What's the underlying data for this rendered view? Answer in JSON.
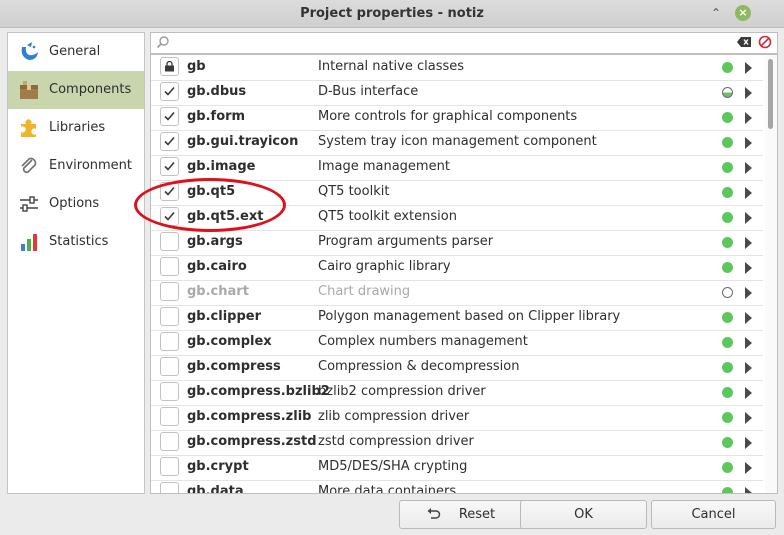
{
  "window": {
    "title": "Project properties - notiz"
  },
  "sidebar": {
    "items": [
      {
        "label": "General",
        "icon": "gambas-logo-icon",
        "active": false
      },
      {
        "label": "Components",
        "icon": "box-icon",
        "active": true
      },
      {
        "label": "Libraries",
        "icon": "puzzle-icon",
        "active": false
      },
      {
        "label": "Environment",
        "icon": "paperclip-icon",
        "active": false
      },
      {
        "label": "Options",
        "icon": "sliders-icon",
        "active": false
      },
      {
        "label": "Statistics",
        "icon": "bar-chart-icon",
        "active": false
      }
    ]
  },
  "search": {
    "value": "",
    "placeholder": ""
  },
  "components": [
    {
      "name": "gb",
      "description": "Internal native classes",
      "state": "locked",
      "status": "ok",
      "disabled": false
    },
    {
      "name": "gb.dbus",
      "description": "D-Bus interface",
      "state": "checked",
      "status": "half",
      "disabled": false
    },
    {
      "name": "gb.form",
      "description": "More controls for graphical components",
      "state": "checked",
      "status": "ok",
      "disabled": false
    },
    {
      "name": "gb.gui.trayicon",
      "description": "System tray icon management component",
      "state": "checked",
      "status": "ok",
      "disabled": false
    },
    {
      "name": "gb.image",
      "description": "Image management",
      "state": "checked",
      "status": "ok",
      "disabled": false
    },
    {
      "name": "gb.qt5",
      "description": "QT5 toolkit",
      "state": "checked",
      "status": "ok",
      "disabled": false
    },
    {
      "name": "gb.qt5.ext",
      "description": "QT5 toolkit extension",
      "state": "checked",
      "status": "ok",
      "disabled": false
    },
    {
      "name": "gb.args",
      "description": "Program arguments parser",
      "state": "unchecked",
      "status": "ok",
      "disabled": false
    },
    {
      "name": "gb.cairo",
      "description": "Cairo graphic library",
      "state": "unchecked",
      "status": "ok",
      "disabled": false
    },
    {
      "name": "gb.chart",
      "description": "Chart drawing",
      "state": "unchecked",
      "status": "empty",
      "disabled": true
    },
    {
      "name": "gb.clipper",
      "description": "Polygon management based on Clipper library",
      "state": "unchecked",
      "status": "ok",
      "disabled": false
    },
    {
      "name": "gb.complex",
      "description": "Complex numbers management",
      "state": "unchecked",
      "status": "ok",
      "disabled": false
    },
    {
      "name": "gb.compress",
      "description": "Compression & decompression",
      "state": "unchecked",
      "status": "ok",
      "disabled": false
    },
    {
      "name": "gb.compress.bzlib2",
      "description": "bzlib2 compression driver",
      "state": "unchecked",
      "status": "ok",
      "disabled": false
    },
    {
      "name": "gb.compress.zlib",
      "description": "zlib compression driver",
      "state": "unchecked",
      "status": "ok",
      "disabled": false
    },
    {
      "name": "gb.compress.zstd",
      "description": "zstd compression driver",
      "state": "unchecked",
      "status": "ok",
      "disabled": false
    },
    {
      "name": "gb.crypt",
      "description": "MD5/DES/SHA crypting",
      "state": "unchecked",
      "status": "ok",
      "disabled": false
    },
    {
      "name": "gb.data",
      "description": "More data containers",
      "state": "unchecked",
      "status": "ok",
      "disabled": false
    }
  ],
  "buttons": {
    "reset": "Reset",
    "ok": "OK",
    "cancel": "Cancel"
  },
  "colors": {
    "active_sidebar": "#c9d6ad",
    "status_ok": "#5cc85c",
    "annotation": "#e0101a"
  }
}
